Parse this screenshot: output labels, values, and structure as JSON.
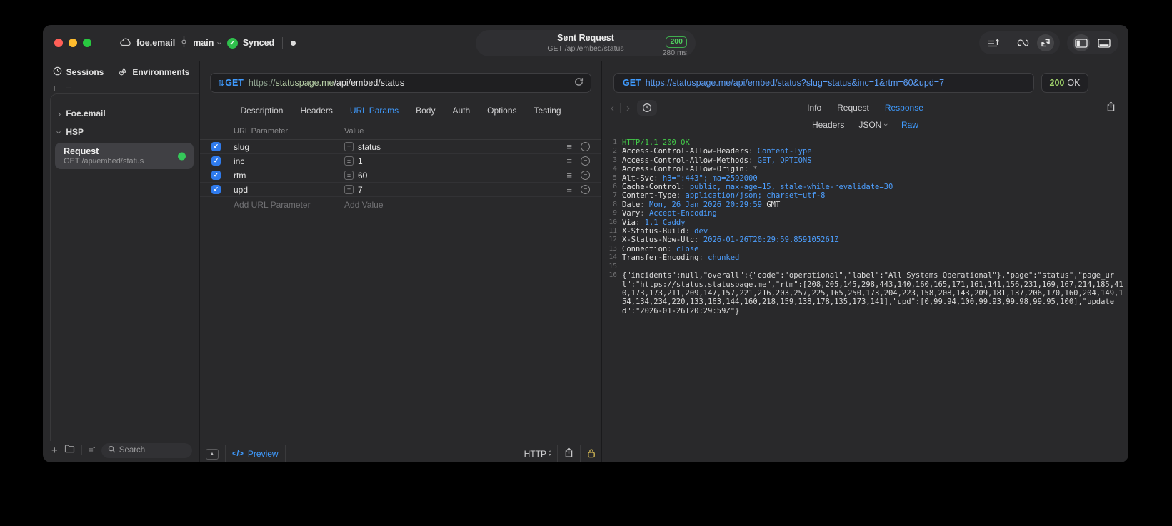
{
  "titlebar": {
    "project": "foe.email",
    "branch": "main",
    "synced": "Synced",
    "request_title": "Sent Request",
    "request_subtitle": "GET /api/embed/status",
    "status_code": "200",
    "duration": "280 ms"
  },
  "sidebar": {
    "tabs": [
      {
        "label": "Sessions"
      },
      {
        "label": "Environments"
      }
    ],
    "groups": [
      {
        "label": "Foe.email",
        "expanded": false
      },
      {
        "label": "HSP",
        "expanded": true
      }
    ],
    "request_item": {
      "title": "Request",
      "subtitle": "GET /api/embed/status"
    },
    "search_placeholder": "Search"
  },
  "request_panel": {
    "method": "GET",
    "url": {
      "scheme": "https://",
      "domain": "statuspage.me",
      "path": "/api/embed/status"
    },
    "tabs": [
      {
        "label": "Description"
      },
      {
        "label": "Headers"
      },
      {
        "label": "URL Params",
        "active": true
      },
      {
        "label": "Body"
      },
      {
        "label": "Auth"
      },
      {
        "label": "Options"
      },
      {
        "label": "Testing"
      }
    ],
    "table": {
      "col_param": "URL Parameter",
      "col_value": "Value",
      "eq": "=",
      "rows": [
        {
          "name": "slug",
          "value": "status",
          "checked": true
        },
        {
          "name": "inc",
          "value": "1",
          "checked": true
        },
        {
          "name": "rtm",
          "value": "60",
          "checked": true
        },
        {
          "name": "upd",
          "value": "7",
          "checked": true
        }
      ],
      "add_param": "Add URL Parameter",
      "add_value": "Add Value"
    },
    "footer": {
      "code_glyph": "</>",
      "preview": "Preview",
      "protocol": "HTTP"
    }
  },
  "response_panel": {
    "method": "GET",
    "url": "https://statuspage.me/api/embed/status?slug=status&inc=1&rtm=60&upd=7",
    "status_code": "200",
    "status_text": "OK",
    "tabs": [
      {
        "label": "Info"
      },
      {
        "label": "Request"
      },
      {
        "label": "Response",
        "active": true
      }
    ],
    "subtabs": [
      {
        "label": "Headers"
      },
      {
        "label": "JSON",
        "caret": true
      },
      {
        "label": "Raw",
        "active": true
      }
    ],
    "lines": [
      {
        "n": "1",
        "parts": [
          {
            "c": "g",
            "t": "HTTP/1.1 200 OK"
          }
        ]
      },
      {
        "n": "2",
        "parts": [
          {
            "c": "k",
            "t": "Access-Control-Allow-Headers"
          },
          {
            "c": "p",
            "t": ": "
          },
          {
            "c": "v",
            "t": "Content-Type"
          }
        ]
      },
      {
        "n": "3",
        "parts": [
          {
            "c": "k",
            "t": "Access-Control-Allow-Methods"
          },
          {
            "c": "p",
            "t": ": "
          },
          {
            "c": "v",
            "t": "GET, OPTIONS"
          }
        ]
      },
      {
        "n": "4",
        "parts": [
          {
            "c": "k",
            "t": "Access-Control-Allow-Origin"
          },
          {
            "c": "p",
            "t": ": "
          },
          {
            "c": "p",
            "t": "*"
          }
        ]
      },
      {
        "n": "5",
        "parts": [
          {
            "c": "k",
            "t": "Alt-Svc"
          },
          {
            "c": "p",
            "t": ": "
          },
          {
            "c": "v",
            "t": "h3=\":443\"; ma=2592000"
          }
        ]
      },
      {
        "n": "6",
        "parts": [
          {
            "c": "k",
            "t": "Cache-Control"
          },
          {
            "c": "p",
            "t": ": "
          },
          {
            "c": "v",
            "t": "public, max-age=15, stale-while-revalidate=30"
          }
        ]
      },
      {
        "n": "7",
        "parts": [
          {
            "c": "k",
            "t": "Content-Type"
          },
          {
            "c": "p",
            "t": ": "
          },
          {
            "c": "v",
            "t": "application/json; charset=utf-8"
          }
        ]
      },
      {
        "n": "8",
        "parts": [
          {
            "c": "k",
            "t": "Date"
          },
          {
            "c": "p",
            "t": ": "
          },
          {
            "c": "v",
            "t": "Mon, 26 Jan 2026 20:29:59"
          },
          {
            "c": "w",
            "t": " GMT"
          }
        ]
      },
      {
        "n": "9",
        "parts": [
          {
            "c": "k",
            "t": "Vary"
          },
          {
            "c": "p",
            "t": ": "
          },
          {
            "c": "v",
            "t": "Accept-Encoding"
          }
        ]
      },
      {
        "n": "10",
        "parts": [
          {
            "c": "k",
            "t": "Via"
          },
          {
            "c": "p",
            "t": ": "
          },
          {
            "c": "v",
            "t": "1.1 Caddy"
          }
        ]
      },
      {
        "n": "11",
        "parts": [
          {
            "c": "k",
            "t": "X-Status-Build"
          },
          {
            "c": "p",
            "t": ": "
          },
          {
            "c": "v",
            "t": "dev"
          }
        ]
      },
      {
        "n": "12",
        "parts": [
          {
            "c": "k",
            "t": "X-Status-Now-Utc"
          },
          {
            "c": "p",
            "t": ": "
          },
          {
            "c": "v",
            "t": "2026-01-26T20:29:59.859105261Z"
          }
        ]
      },
      {
        "n": "13",
        "parts": [
          {
            "c": "k",
            "t": "Connection"
          },
          {
            "c": "p",
            "t": ": "
          },
          {
            "c": "v",
            "t": "close"
          }
        ]
      },
      {
        "n": "14",
        "parts": [
          {
            "c": "k",
            "t": "Transfer-Encoding"
          },
          {
            "c": "p",
            "t": ": "
          },
          {
            "c": "v",
            "t": "chunked"
          }
        ]
      },
      {
        "n": "15",
        "parts": []
      },
      {
        "n": "16",
        "parts": [
          {
            "c": "w",
            "t": "{\"incidents\":null,\"overall\":{\"code\":\"operational\",\"label\":\"All Systems Operational\"},\"page\":\"status\",\"page_url\":\"https://status.statuspage.me\",\"rtm\":[208,205,145,298,443,140,160,165,171,161,141,156,231,169,167,214,185,410,173,173,211,209,147,157,221,216,203,257,225,165,250,173,204,223,158,208,143,209,181,137,206,170,160,204,149,154,134,234,220,133,163,144,160,218,159,138,178,135,173,141],\"upd\":[0,99.94,100,99.93,99.98,99.95,100],\"updated\":\"2026-01-26T20:29:59Z\"}"
          }
        ]
      }
    ]
  },
  "colors": {
    "accent_blue": "#3f9bff",
    "response_green": "#43c949",
    "value_blue": "#4d9fff",
    "checkbox_blue": "#2f7bed",
    "badge_green": "#4fd05e",
    "traffic_red": "#ff5f57",
    "traffic_yellow": "#febc2e",
    "traffic_green": "#28c840"
  }
}
